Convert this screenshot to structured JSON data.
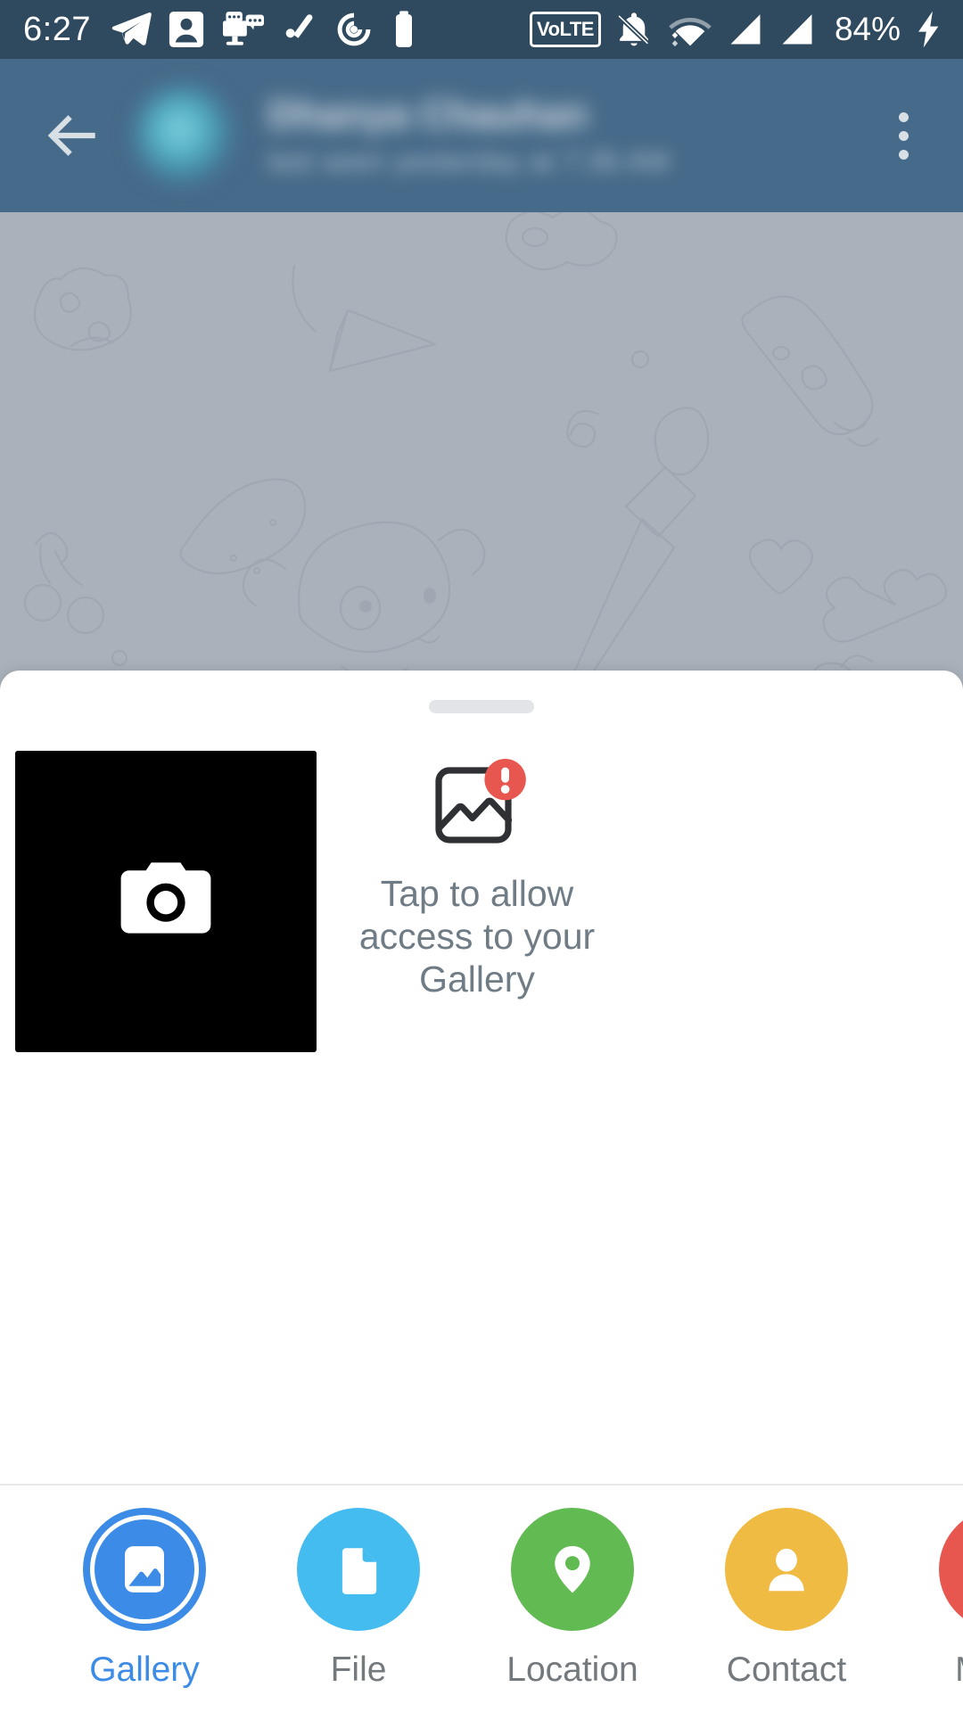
{
  "status_bar": {
    "clock": "6:27",
    "battery_percent": "84%",
    "volte_label": "VoLTE",
    "icons_left": [
      "telegram-icon",
      "contact-card-icon",
      "screen-chat-icon",
      "pen-icon",
      "podcast-icon",
      "battery-icon"
    ],
    "icons_right": [
      "volte-icon",
      "notifications-muted-icon",
      "wifi-icon",
      "signal-sim1-icon",
      "signal-sim2-icon",
      "charging-bolt-icon"
    ],
    "background_color": "#2f4a5e",
    "foreground_color": "#ffffff"
  },
  "toolbar": {
    "back_label": "Back",
    "chat_name": "Dhanya Chauhan",
    "chat_status": "last seen yesterday at 7:36 AM",
    "overflow_label": "More options",
    "background_color": "#466a89",
    "name_blurred": true,
    "status_blurred": true,
    "avatar_blurred": true
  },
  "chat": {
    "wallpaper": "doodle-pattern",
    "wallpaper_color": "#a9b1ba",
    "dimmed": true
  },
  "sheet": {
    "drag_handle_label": "Drag handle",
    "camera_tile": {
      "label": "Open camera",
      "icon": "camera-icon",
      "background_color": "#000000"
    },
    "gallery_permission": {
      "icon": "image-alert-icon",
      "badge_color": "#e8574f",
      "text": "Tap to allow access to your Gallery",
      "text_color": "#707c85"
    }
  },
  "bottom_nav": {
    "items": [
      {
        "label": "Gallery",
        "icon": "gallery-icon",
        "color": "#3c8ce7",
        "selected": true
      },
      {
        "label": "File",
        "icon": "file-icon",
        "color": "#45bcf0",
        "selected": false
      },
      {
        "label": "Location",
        "icon": "location-pin-icon",
        "color": "#62bb52",
        "selected": false
      },
      {
        "label": "Contact",
        "icon": "contact-icon",
        "color": "#f0bb43",
        "selected": false
      },
      {
        "label": "Music",
        "icon": "music-play-icon",
        "color": "#e8574f",
        "selected": false
      }
    ],
    "active_color": "#3c8ce7",
    "inactive_color": "#74797e"
  }
}
